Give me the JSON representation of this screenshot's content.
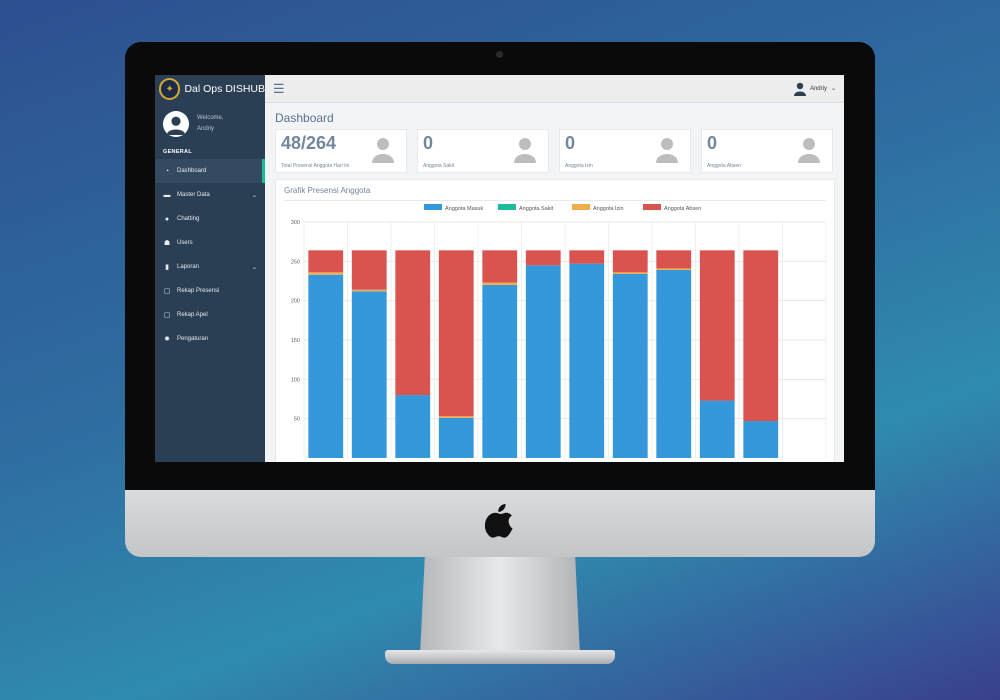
{
  "app": {
    "brand": "Dal Ops DISHUB",
    "welcome": "Welcome,",
    "user": "Andriy"
  },
  "sidebar": {
    "section": "GENERAL",
    "items": [
      {
        "label": "Dashboard",
        "icon": "dashboard-icon",
        "active": true
      },
      {
        "label": "Master Data",
        "icon": "folder-icon",
        "expandable": true
      },
      {
        "label": "Chatting",
        "icon": "comments-icon"
      },
      {
        "label": "Users",
        "icon": "users-icon"
      },
      {
        "label": "Laporan",
        "icon": "file-icon",
        "expandable": true
      },
      {
        "label": "Rekap Presensi",
        "icon": "excel-file-icon"
      },
      {
        "label": "Rekap Apel",
        "icon": "excel-file-icon"
      },
      {
        "label": "Pengaturan",
        "icon": "gear-icon"
      }
    ]
  },
  "topbar": {
    "user": "Andriy"
  },
  "page": {
    "title": "Dashboard"
  },
  "tiles": [
    {
      "count": "48/264",
      "label": "Total Presensi Anggota Hari Ini"
    },
    {
      "count": "0",
      "label": "Anggota Sakit"
    },
    {
      "count": "0",
      "label": "Anggota Izin"
    },
    {
      "count": "0",
      "label": "Anggota Absen"
    }
  ],
  "panel": {
    "title": "Grafik Presensi Anggota"
  },
  "colors": {
    "masuk": "#3498db",
    "sakit": "#1abc9c",
    "izin": "#f0ad4e",
    "absen": "#d9534f"
  },
  "chart_data": {
    "type": "bar",
    "stacked": true,
    "categories": [
      "",
      "",
      "",
      "",
      "",
      "",
      "",
      "",
      "",
      "",
      "",
      ""
    ],
    "series": [
      {
        "name": "Anggota Masuk",
        "values": [
          233,
          212,
          80,
          51,
          220,
          245,
          247,
          234,
          239,
          73,
          47,
          0
        ]
      },
      {
        "name": "Anggota Sakit",
        "values": [
          0,
          0,
          0,
          0,
          0,
          0,
          0,
          0,
          0,
          0,
          0,
          0
        ]
      },
      {
        "name": "Anggota Izin",
        "values": [
          3,
          2,
          0,
          2,
          3,
          0,
          0,
          2,
          2,
          0,
          0,
          0
        ]
      },
      {
        "name": "Anggota Absen",
        "values": [
          28,
          50,
          184,
          211,
          41,
          19,
          17,
          28,
          23,
          191,
          217,
          0
        ]
      }
    ],
    "yticks": [
      50,
      100,
      150,
      200,
      250,
      300
    ],
    "ylim": [
      0,
      300
    ],
    "grid": true,
    "legend": "top-center"
  }
}
